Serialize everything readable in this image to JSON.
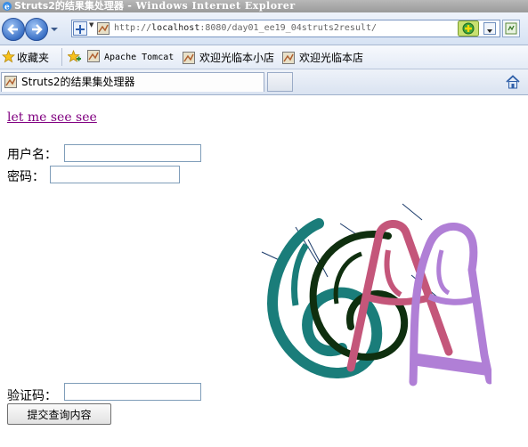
{
  "window": {
    "title": "Struts2的结果集处理器",
    "title_suffix": " - Windows Internet Explorer",
    "icon": "ie-icon"
  },
  "nav": {
    "back_icon": "back-arrow-icon",
    "forward_icon": "forward-arrow-icon",
    "address": {
      "prefix": "http://",
      "host": "localhost",
      "rest": ":8080/day01_ee19_04struts2result/"
    },
    "go_icon": "go-icon",
    "refresh_icon": "refresh-icon"
  },
  "favorites": {
    "label": "收藏夹",
    "links": [
      {
        "label": "Apache Tomcat"
      },
      {
        "label": "欢迎光临本小店"
      },
      {
        "label": "欢迎光临本店"
      }
    ]
  },
  "tabs": {
    "active_label": "Struts2的结果集处理器",
    "home_icon": "home-icon"
  },
  "page": {
    "link_text": "let me see see",
    "username_label": "用户名：",
    "username_value": "",
    "password_label": "密码：",
    "password_value": "",
    "captcha_label": "验证码：",
    "captcha_value": "",
    "captcha_text": "6A",
    "submit_label": "提交查询内容",
    "colors": {
      "link": "#800080",
      "captcha_teal": "#1a7d7a",
      "captcha_dark": "#0f2f0f",
      "captcha_rose": "#c4567a",
      "captcha_lavender": "#b07fd6"
    }
  }
}
